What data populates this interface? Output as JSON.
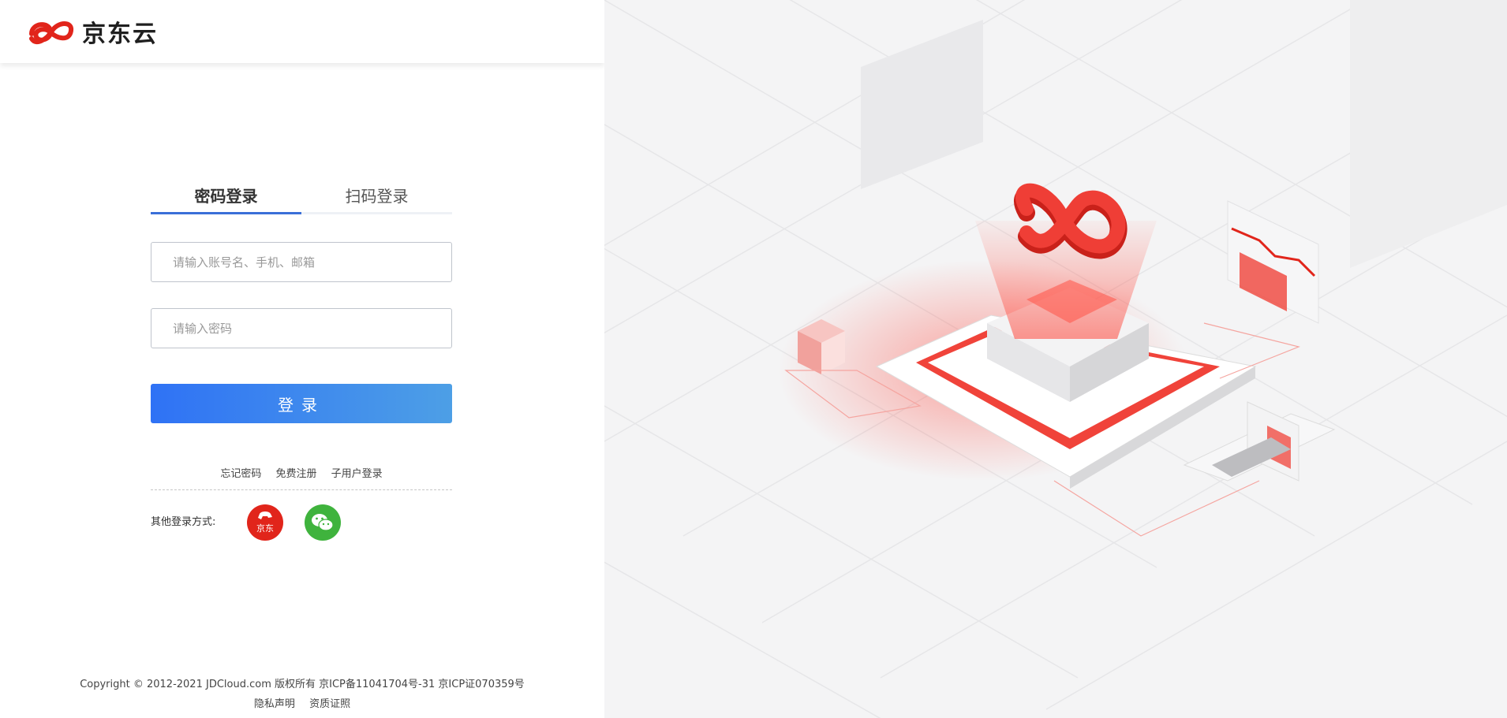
{
  "brand": {
    "name": "京东云",
    "accent": "#e1251b",
    "primary": "#2f72f5"
  },
  "tabs": [
    {
      "label": "密码登录",
      "active": true
    },
    {
      "label": "扫码登录",
      "active": false
    }
  ],
  "form": {
    "account_placeholder": "请输入账号名、手机、邮箱",
    "password_placeholder": "请输入密码",
    "login_label": "登录"
  },
  "links": {
    "forgot": "忘记密码",
    "register": "免费注册",
    "sub_user": "子用户登录"
  },
  "other_login": {
    "label": "其他登录方式:",
    "jd_text": "京东"
  },
  "footer": {
    "copyright": "Copyright © 2012-2021 JDCloud.com 版权所有 京ICP备11041704号-31 京ICP证070359号",
    "privacy": "隐私声明",
    "license": "资质证照"
  }
}
